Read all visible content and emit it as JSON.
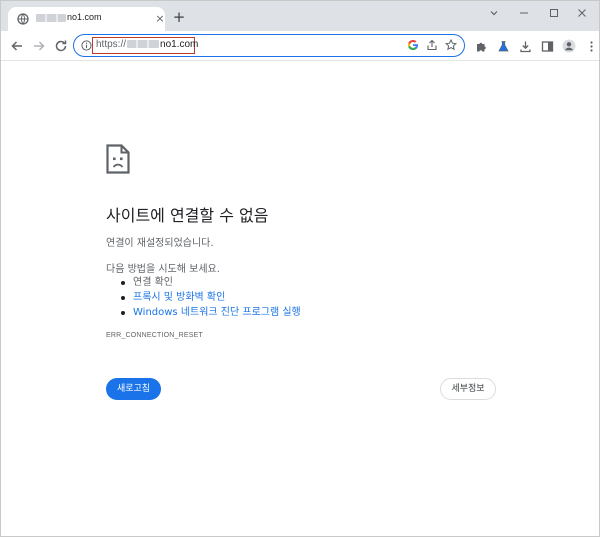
{
  "tab": {
    "title_visible": "no1.com",
    "close_glyph": "×",
    "new_tab_glyph": "+"
  },
  "window_controls": {
    "tabs_menu_glyph": "⌄",
    "minimize_glyph": "—",
    "maximize_glyph": "☐",
    "close_glyph": "✕"
  },
  "omnibox": {
    "scheme": "https://",
    "host_visible": "no1.com",
    "highlight_color": "#c0392b"
  },
  "icons": {
    "tab_favicon": "globe-icon",
    "back": "back-arrow-icon",
    "forward": "forward-arrow-icon",
    "reload": "reload-icon",
    "site_info": "info-icon",
    "google": "google-icon",
    "share": "share-icon",
    "bookmark": "star-icon",
    "extensions": "puzzle-icon",
    "labs": "flask-icon",
    "downloads": "download-icon",
    "side_panel": "side-panel-icon",
    "profile": "avatar-icon",
    "menu": "kebab-menu-icon",
    "error": "sad-page-icon"
  },
  "error_page": {
    "title": "사이트에 연결할 수 없음",
    "message": "연결이 재설정되었습니다.",
    "try_heading": "다음 방법을 시도해 보세요.",
    "suggestions": [
      {
        "text": "연결 확인",
        "link": false
      },
      {
        "text": "프록시 및 방화벽 확인",
        "link": true
      },
      {
        "text": "Windows 네트워크 진단 프로그램 실행",
        "link": true
      }
    ],
    "error_code": "ERR_CONNECTION_RESET",
    "reload_button": "새로고침",
    "details_button": "세부정보"
  },
  "colors": {
    "accent": "#1a73e8",
    "tabstrip_bg": "#dee1e6",
    "text_primary": "#202124",
    "text_secondary": "#5f6368"
  }
}
